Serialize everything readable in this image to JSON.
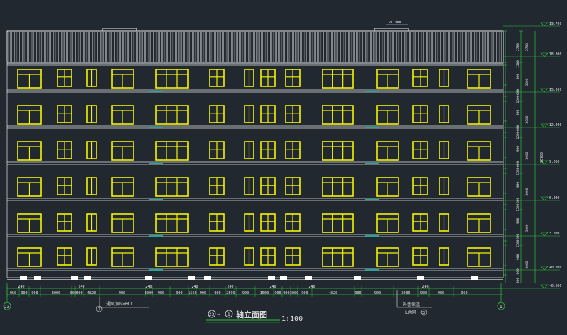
{
  "drawing": {
    "title_axis_start": "23",
    "title_sep": "~",
    "title_axis_end": "1",
    "title_text": "轴立面图",
    "title_scale": "1:100",
    "roof_label": "21.000",
    "callout_vent": "通风洞b≥600",
    "callout_vent_ref": "3",
    "callout_wall_a": "外墙保温",
    "callout_wall_b": "L余同",
    "callout_wall_ref": "3",
    "axis_left": "23",
    "axis_right": "1"
  },
  "floor_levels": [
    "19.700",
    "18.000",
    "15.000",
    "12.000",
    "9.000",
    "6.000",
    "3.000",
    "±0.000",
    "-0.600"
  ],
  "right_dims_a": [
    "2700",
    "1500",
    "900",
    "600",
    "1500",
    "900",
    "600",
    "1500",
    "900",
    "600",
    "1500",
    "900",
    "600",
    "1500",
    "900",
    "600",
    "1500",
    "900",
    "600",
    "900"
  ],
  "right_dims_b": [
    "2700",
    "3000",
    "3000",
    "3000",
    "3000",
    "3000",
    "3000"
  ],
  "right_total": "20700",
  "bottom_dims_top": [
    "240",
    "240",
    "240",
    "240",
    "240",
    "240",
    "240",
    "240"
  ],
  "bottom_dims": [
    "960",
    "900",
    "900",
    "3000",
    "600",
    "900",
    "4820",
    "900",
    "3000",
    "900",
    "900",
    "1560",
    "900",
    "900",
    "2599",
    "900",
    "1560",
    "900",
    "900",
    "3000",
    "900",
    "4820",
    "900",
    "900",
    "3000",
    "900",
    "900",
    "960"
  ],
  "colors": {
    "bg": "#212830",
    "window": "#f2f200",
    "lines": "#e6e6e6",
    "dim": "#2fc43a",
    "teal": "#2aa39a",
    "text": "#e8e8e8"
  }
}
